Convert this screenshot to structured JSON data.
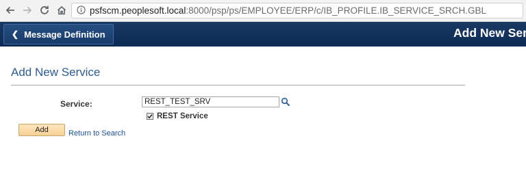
{
  "browser": {
    "url_host": "psfscm.peoplesoft.local",
    "url_path": ":8000/psp/ps/EMPLOYEE/ERP/c/IB_PROFILE.IB_SERVICE_SRCH.GBL",
    "icons": [
      "back-arrow-icon",
      "forward-arrow-icon",
      "reload-icon",
      "home-icon",
      "info-icon"
    ]
  },
  "header": {
    "back_label": "Message Definition",
    "title": "Add New Service"
  },
  "page": {
    "title": "Add New Service",
    "service_label": "Service:",
    "service_value": "REST_TEST_SRV",
    "rest_label": "REST Service",
    "rest_checked": true,
    "add_label": "Add",
    "return_label": "Return to Search"
  },
  "colors": {
    "header_bg": "#12325c",
    "title_blue": "#2f5b8c",
    "button_orange": "#f7d194",
    "link_blue": "#1b4f8f"
  }
}
